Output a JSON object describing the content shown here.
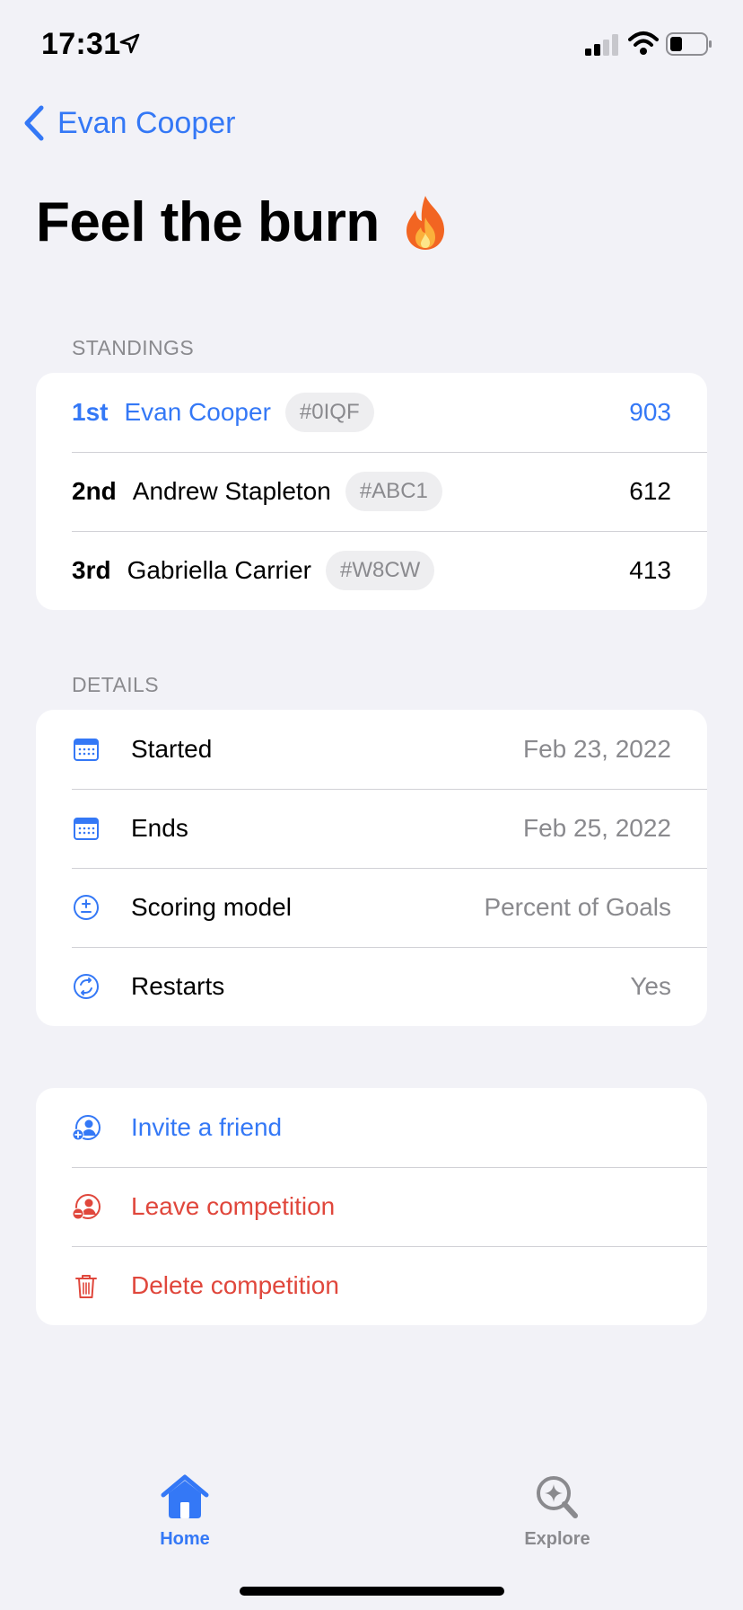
{
  "status_bar": {
    "time": "17:31"
  },
  "nav": {
    "back_label": "Evan Cooper"
  },
  "title": {
    "text": "Feel the burn"
  },
  "standings": {
    "header": "STANDINGS",
    "rows": [
      {
        "rank": "1st",
        "name": "Evan Cooper",
        "tag": "#0IQF",
        "score": "903",
        "highlighted": true
      },
      {
        "rank": "2nd",
        "name": "Andrew Stapleton",
        "tag": "#ABC1",
        "score": "612",
        "highlighted": false
      },
      {
        "rank": "3rd",
        "name": "Gabriella Carrier",
        "tag": "#W8CW",
        "score": "413",
        "highlighted": false
      }
    ]
  },
  "details": {
    "header": "DETAILS",
    "rows": [
      {
        "icon": "calendar-icon",
        "label": "Started",
        "value": "Feb 23, 2022"
      },
      {
        "icon": "calendar-icon",
        "label": "Ends",
        "value": "Feb 25, 2022"
      },
      {
        "icon": "plus-minus-icon",
        "label": "Scoring model",
        "value": "Percent of Goals"
      },
      {
        "icon": "restart-icon",
        "label": "Restarts",
        "value": "Yes"
      }
    ]
  },
  "actions": [
    {
      "icon": "add-person-icon",
      "label": "Invite a friend",
      "color": "#3478f6"
    },
    {
      "icon": "remove-person-icon",
      "label": "Leave competition",
      "color": "#e0473c"
    },
    {
      "icon": "trash-icon",
      "label": "Delete competition",
      "color": "#e0473c"
    }
  ],
  "tab_bar": {
    "tabs": [
      {
        "icon": "house-icon",
        "label": "Home",
        "selected": true
      },
      {
        "icon": "magnifier-sparkle-icon",
        "label": "Explore",
        "selected": false
      }
    ]
  },
  "colors": {
    "accent": "#3478f6",
    "destructive": "#e0473c",
    "background": "#f2f2f7"
  }
}
